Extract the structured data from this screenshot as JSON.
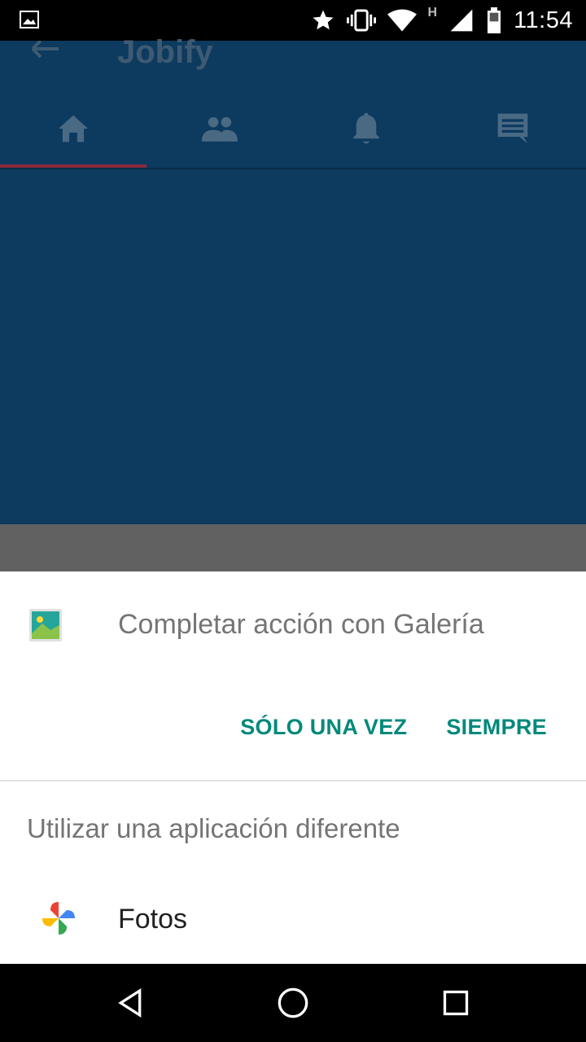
{
  "status_bar": {
    "time": "11:54",
    "network": "H",
    "icons": [
      "image-notification-icon",
      "star-icon",
      "vibrate-icon",
      "wifi-icon",
      "signal-icon",
      "battery-icon"
    ]
  },
  "app": {
    "title": "Jobify",
    "tabs": [
      {
        "icon": "home-icon",
        "active": true
      },
      {
        "icon": "people-icon",
        "active": false
      },
      {
        "icon": "bell-icon",
        "active": false
      },
      {
        "icon": "chat-icon",
        "active": false
      }
    ],
    "colors": {
      "primary": "#0d3a5f",
      "indicator": "#8a2a3e"
    }
  },
  "chooser": {
    "title": "Completar acción con Galería",
    "once_label": "SÓLO UNA VEZ",
    "always_label": "SIEMPRE",
    "other_label": "Utilizar una aplicación diferente",
    "apps": [
      {
        "label": "Fotos",
        "icon": "google-photos-icon"
      }
    ],
    "accent": "#00897b"
  },
  "nav": {
    "buttons": [
      "back-icon",
      "home-circle-icon",
      "recents-icon"
    ]
  }
}
